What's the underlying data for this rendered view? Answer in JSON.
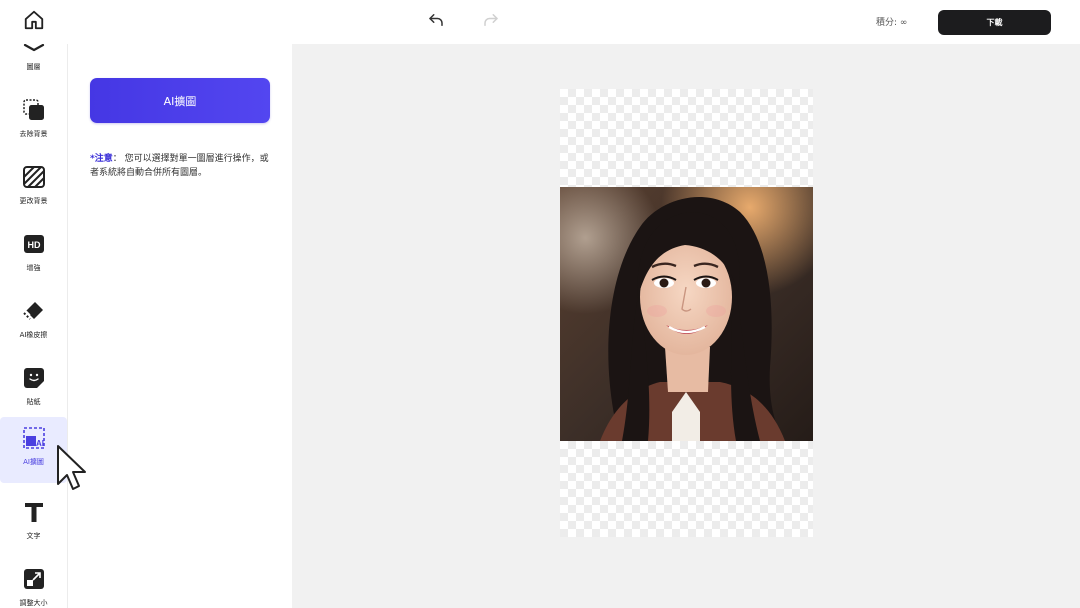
{
  "topbar": {
    "home_icon": "home-icon",
    "undo_icon": "undo-icon",
    "redo_icon": "redo-icon",
    "credits_label": "積分:",
    "credits_value": "∞",
    "download_label": "下載"
  },
  "toolbar": {
    "items": [
      {
        "label": "圖層",
        "icon": "layers-icon"
      },
      {
        "label": "去除背景",
        "icon": "remove-background-icon"
      },
      {
        "label": "更改背景",
        "icon": "change-background-icon"
      },
      {
        "label": "增強",
        "icon": "hd-icon"
      },
      {
        "label": "AI橡皮擦",
        "icon": "eraser-icon"
      },
      {
        "label": "貼紙",
        "icon": "sticker-icon"
      },
      {
        "label": "AI擴圖",
        "icon": "ai-expand-icon"
      },
      {
        "label": "文字",
        "icon": "text-icon"
      },
      {
        "label": "調整大小",
        "icon": "resize-icon"
      }
    ],
    "active_index": 6
  },
  "panel": {
    "ai_button_label": "AI擴圖",
    "note_label": "*注意",
    "note_text": "： 您可以選擇對單一圖層進行操作，或者系統將自動合併所有圖層。"
  },
  "canvas": {
    "photo_description_icon": "portrait-photo"
  },
  "colors": {
    "accent": "#4a3fe0",
    "download_bg": "#1c1c1e",
    "canvas_bg": "#f1f1f1"
  }
}
